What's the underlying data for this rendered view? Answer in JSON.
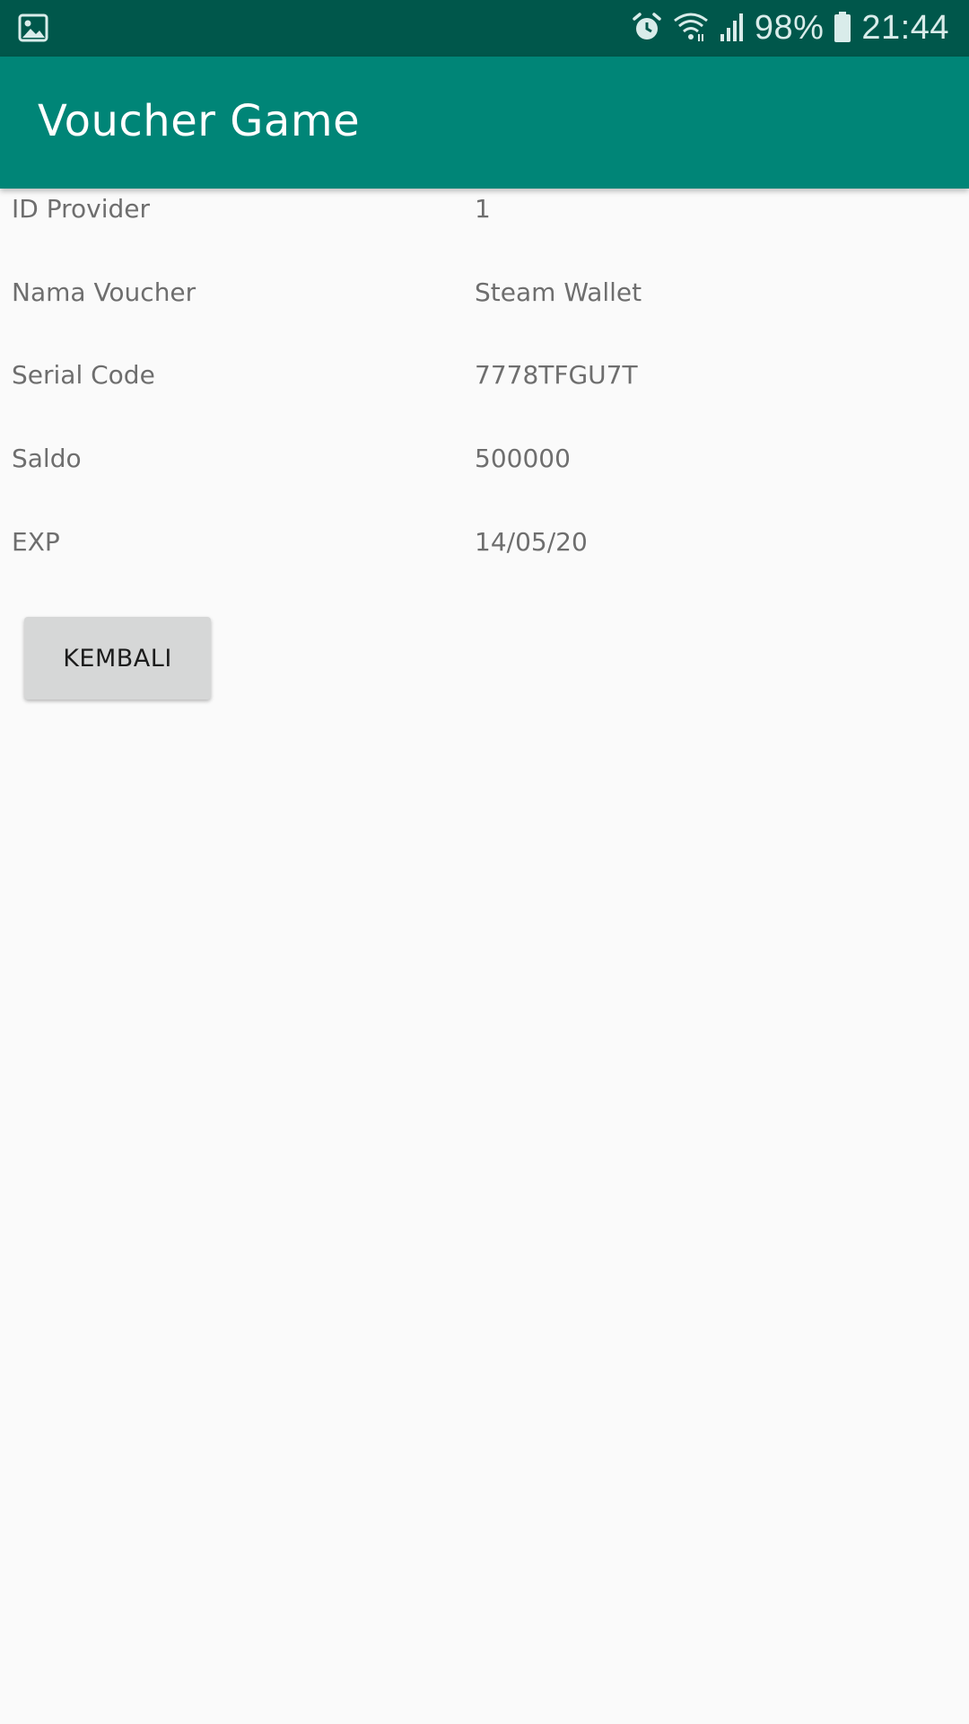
{
  "status_bar": {
    "left_icon": "image-icon",
    "icons": [
      "alarm-icon",
      "wifi-icon",
      "signal-icon",
      "battery-icon"
    ],
    "battery_percent": "98%",
    "time": "21:44"
  },
  "app_bar": {
    "title": "Voucher Game",
    "color": "#008577",
    "status_color": "#00574b"
  },
  "details": {
    "rows": [
      {
        "label": "ID Provider",
        "value": "1"
      },
      {
        "label": "Nama Voucher",
        "value": "Steam Wallet"
      },
      {
        "label": "Serial Code",
        "value": "7778TFGU7T"
      },
      {
        "label": "Saldo",
        "value": "500000"
      },
      {
        "label": "EXP",
        "value": "14/05/20"
      }
    ]
  },
  "actions": {
    "back_label": "KEMBALI"
  }
}
